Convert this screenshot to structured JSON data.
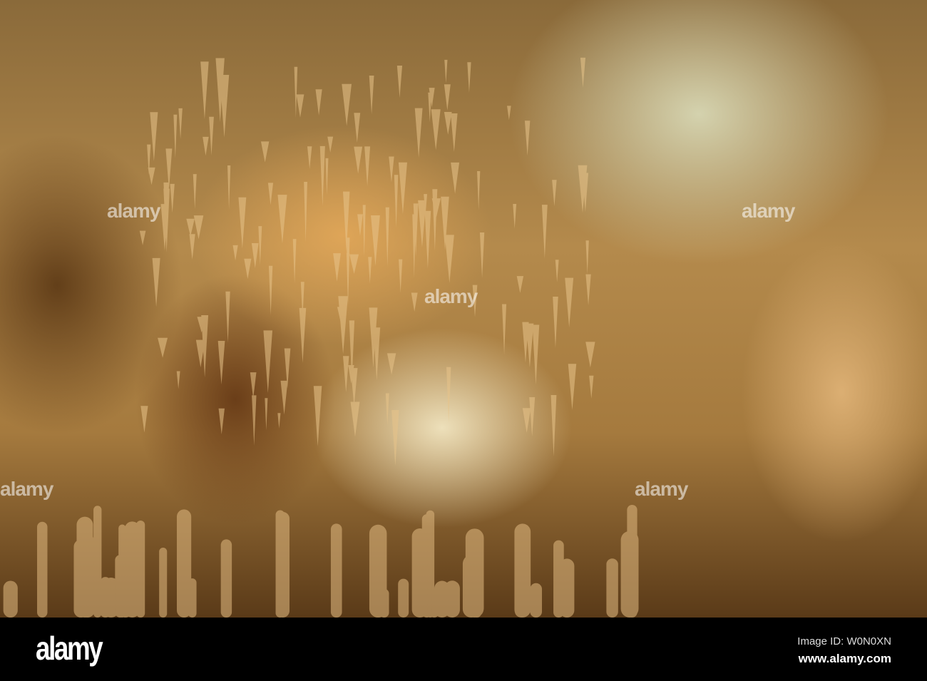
{
  "watermark": {
    "text": "alamy"
  },
  "footer": {
    "logo": "alamy",
    "image_id": "Image ID: W0N0XN",
    "url": "www.alamy.com"
  }
}
